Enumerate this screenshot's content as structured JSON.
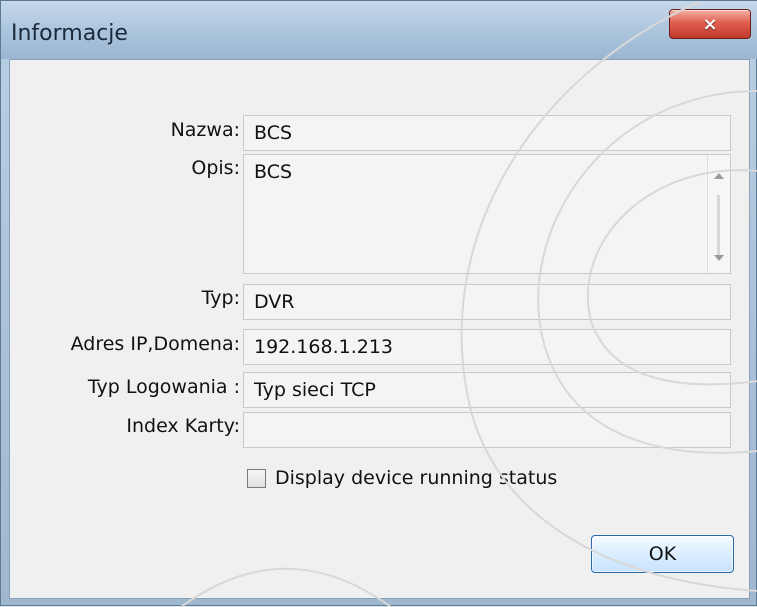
{
  "window": {
    "title": "Informacje",
    "close_label": "×"
  },
  "form": {
    "fields": [
      {
        "label": "Nazwa:",
        "value": "BCS"
      },
      {
        "label": "Opis:",
        "value": "BCS"
      },
      {
        "label": "Typ:",
        "value": "DVR"
      },
      {
        "label": "Adres IP,Domena:",
        "value": "192.168.1.213"
      },
      {
        "label": "Typ Logowania :",
        "value": "Typ sieci TCP"
      },
      {
        "label": "Index Karty:",
        "value": ""
      }
    ],
    "checkbox_label": "Display device running status",
    "checkbox_checked": false,
    "ok_label": "OK"
  },
  "icons": {
    "close": "close-icon",
    "scroll_up": "chevron-up-icon",
    "scroll_down": "chevron-down-icon"
  },
  "colors": {
    "title_bar": "#aec7df",
    "close_button": "#c0392b",
    "dialog_bg": "#f0f0f0",
    "field_bg": "#f4f4f4",
    "ok_border": "#2b6aa7"
  }
}
